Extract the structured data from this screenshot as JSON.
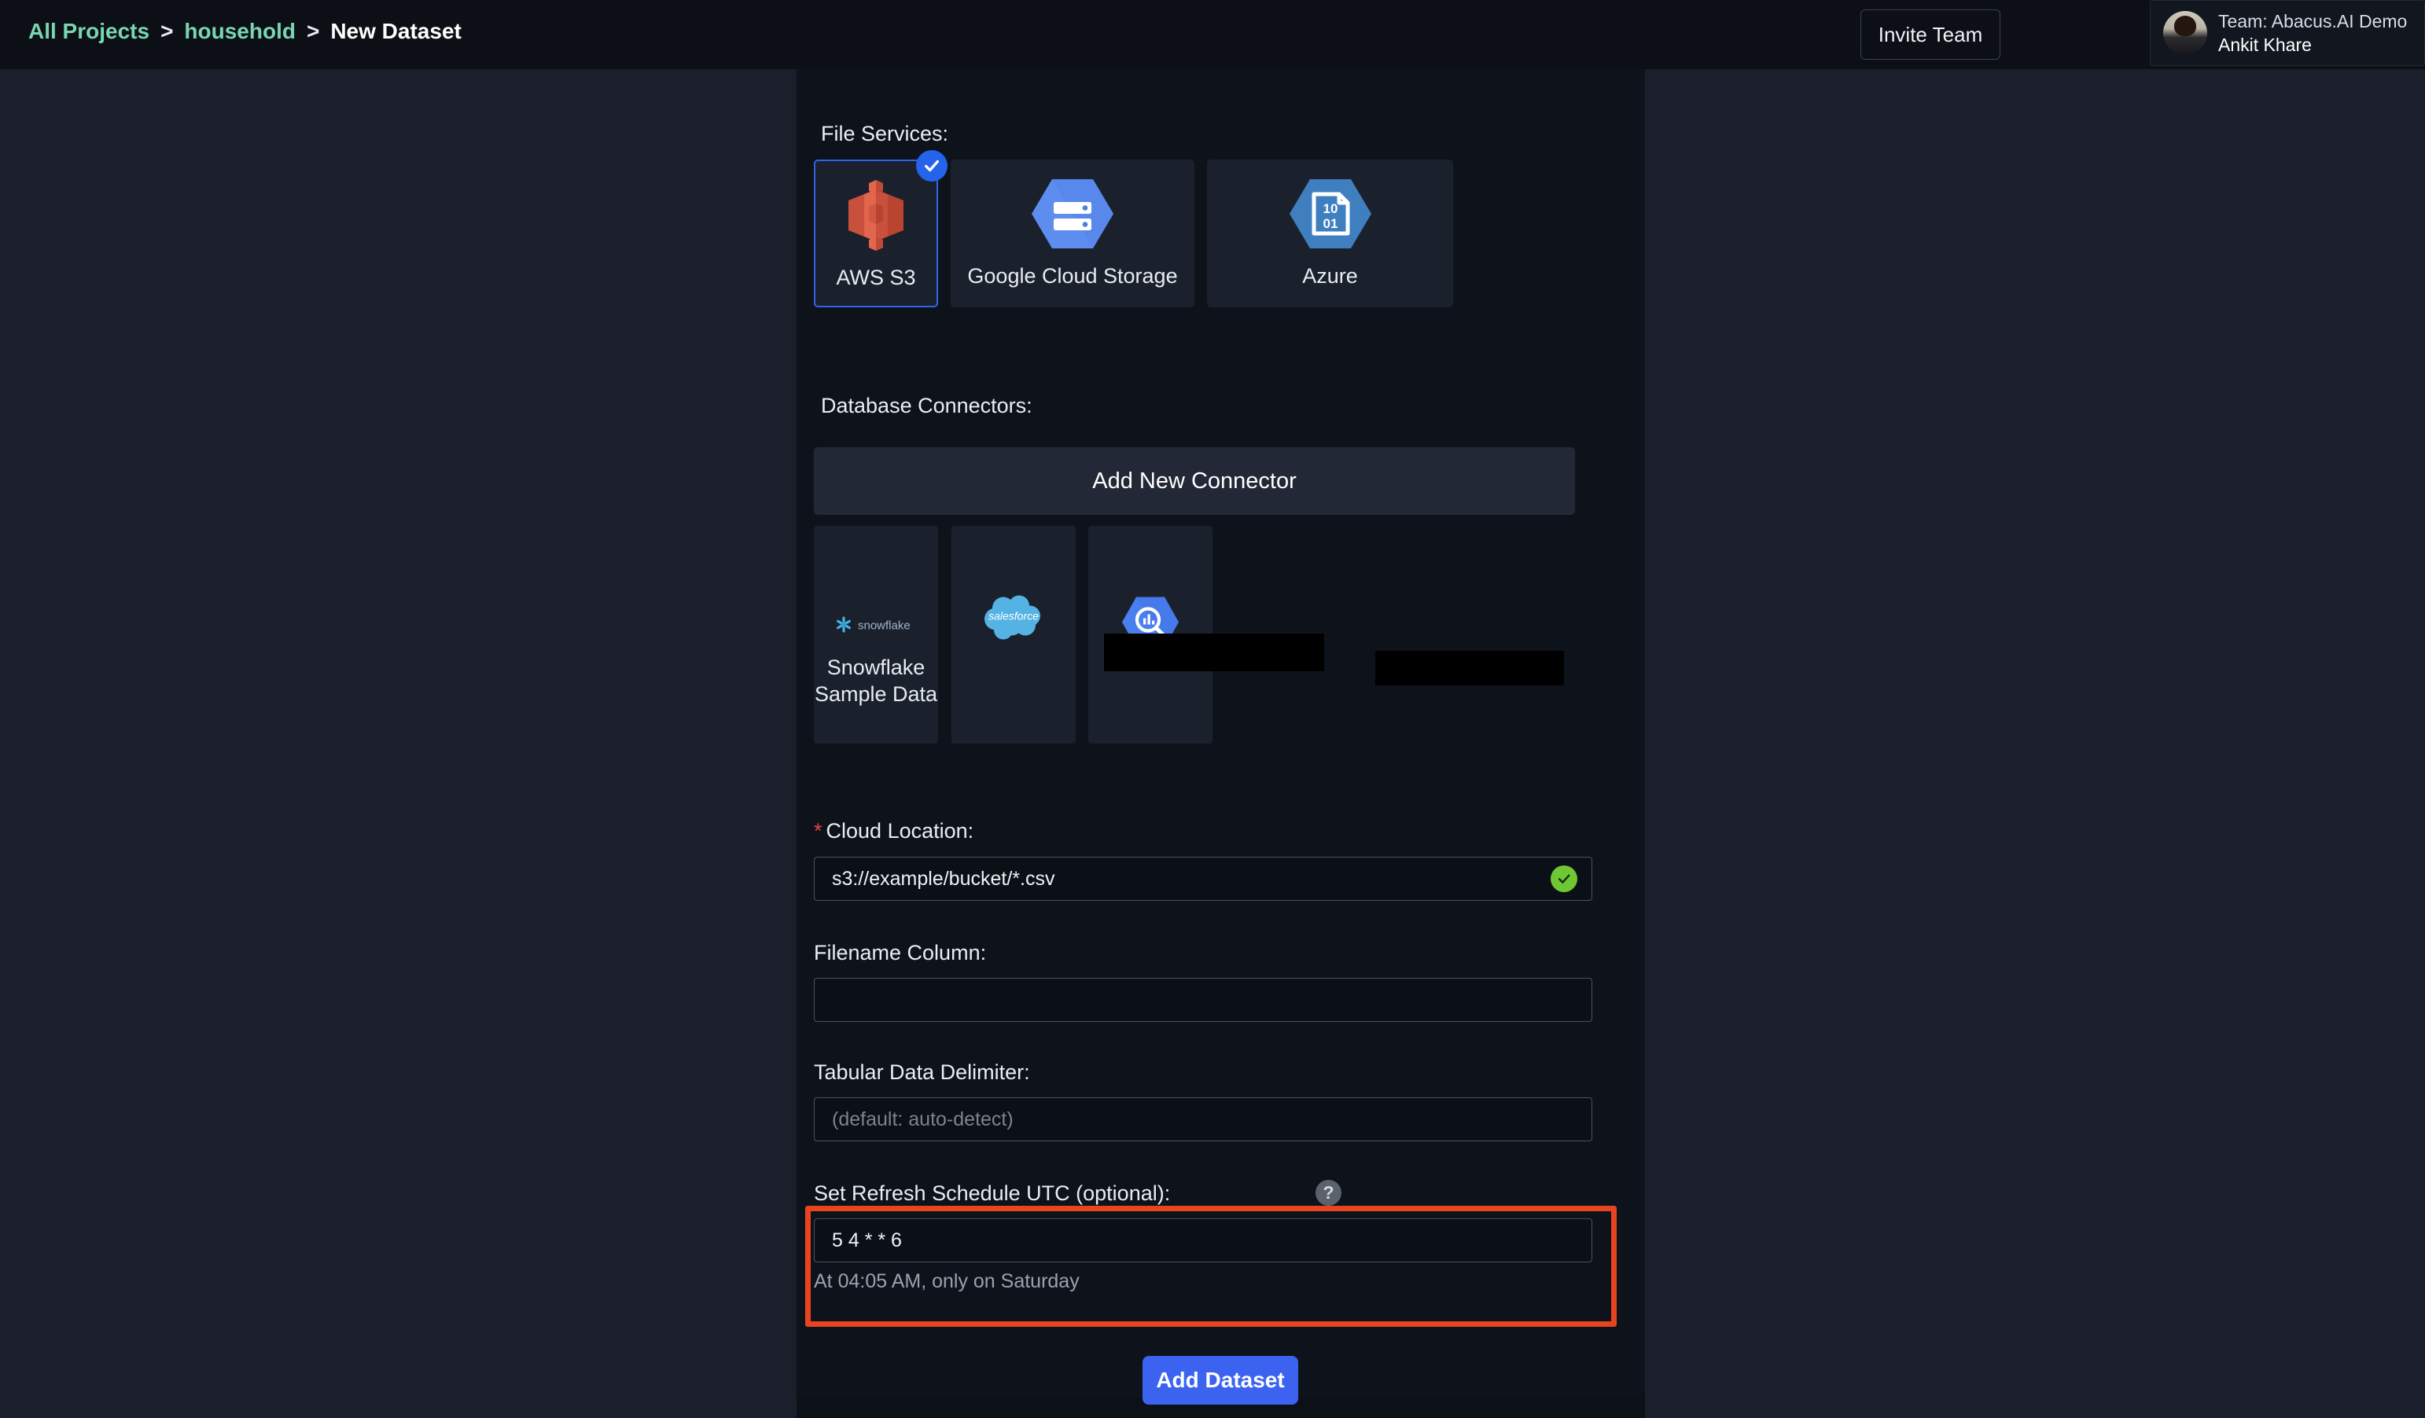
{
  "topbar": {
    "breadcrumb": {
      "all_projects": "All Projects",
      "separator1": ">",
      "project": "household",
      "separator2": ">",
      "current": "New Dataset"
    },
    "invite_button": "Invite Team",
    "user": {
      "team": "Team: Abacus.AI Demo",
      "name": "Ankit Khare"
    }
  },
  "form": {
    "file_services": {
      "label": "File Services:",
      "options": [
        {
          "label": "AWS S3",
          "icon": "aws-s3-icon",
          "selected": true
        },
        {
          "label": "Google Cloud Storage",
          "icon": "google-cloud-storage-icon",
          "selected": false
        },
        {
          "label": "Azure",
          "icon": "azure-blob-icon",
          "selected": false
        }
      ]
    },
    "database_connectors": {
      "label": "Database Connectors:",
      "add_button": "Add New Connector",
      "options": [
        {
          "label": "Snowflake Sample Data",
          "icon": "snowflake-logo",
          "redacted": false
        },
        {
          "label": "",
          "icon": "salesforce-logo",
          "redacted": true
        },
        {
          "label": "",
          "icon": "bigquery-logo",
          "redacted": true
        }
      ]
    },
    "cloud_location": {
      "label": "Cloud Location:",
      "required_marker": "*",
      "value": "s3://example/bucket/*.csv",
      "validation": "valid"
    },
    "filename_column": {
      "label": "Filename Column:",
      "value": "",
      "placeholder": ""
    },
    "tabular_delimiter": {
      "label": "Tabular Data Delimiter:",
      "value": "",
      "placeholder": "(default: auto-detect)"
    },
    "refresh_schedule": {
      "label": "Set Refresh Schedule UTC (optional):",
      "help_icon": "?",
      "value": "5 4 * * 6",
      "hint": "At 04:05 AM, only on Saturday",
      "highlighted": true
    },
    "submit_button": "Add Dataset"
  },
  "colors": {
    "accent_blue": "#3b63f0",
    "selected_border": "#2f63e8",
    "highlight_orange": "#e8441f",
    "valid_green": "#6fc734",
    "breadcrumb_green": "#79d6b0",
    "panel_bg": "#0e131b",
    "page_bg": "#1a1f2b"
  }
}
